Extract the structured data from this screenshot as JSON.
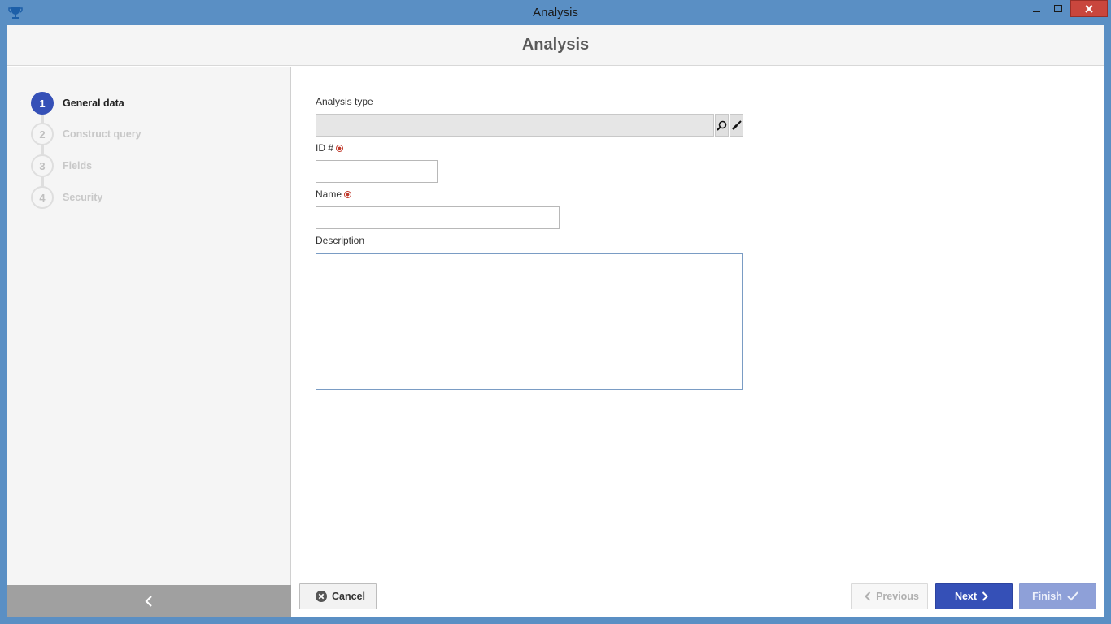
{
  "window": {
    "title": "Analysis",
    "header_title": "Analysis"
  },
  "steps": [
    {
      "number": "1",
      "label": "General data",
      "active": true
    },
    {
      "number": "2",
      "label": "Construct query",
      "active": false
    },
    {
      "number": "3",
      "label": "Fields",
      "active": false
    },
    {
      "number": "4",
      "label": "Security",
      "active": false
    }
  ],
  "form": {
    "analysis_type_label": "Analysis type",
    "analysis_type_value": "",
    "id_label": "ID #",
    "id_value": "",
    "name_label": "Name",
    "name_value": "",
    "description_label": "Description",
    "description_value": ""
  },
  "footer": {
    "cancel_label": "Cancel",
    "previous_label": "Previous",
    "next_label": "Next",
    "finish_label": "Finish"
  },
  "icons": {
    "app": "trophy-icon",
    "search": "search-icon",
    "clear": "eraser-icon",
    "collapse": "chevron-left-icon",
    "cancel": "close-circle-icon",
    "previous": "chevron-left-icon",
    "next": "chevron-right-icon",
    "finish": "checkmark-icon"
  },
  "colors": {
    "accent": "#3550b7",
    "titlebar": "#5a8fc4",
    "close_button": "#c9463d",
    "required": "#c0392b"
  }
}
